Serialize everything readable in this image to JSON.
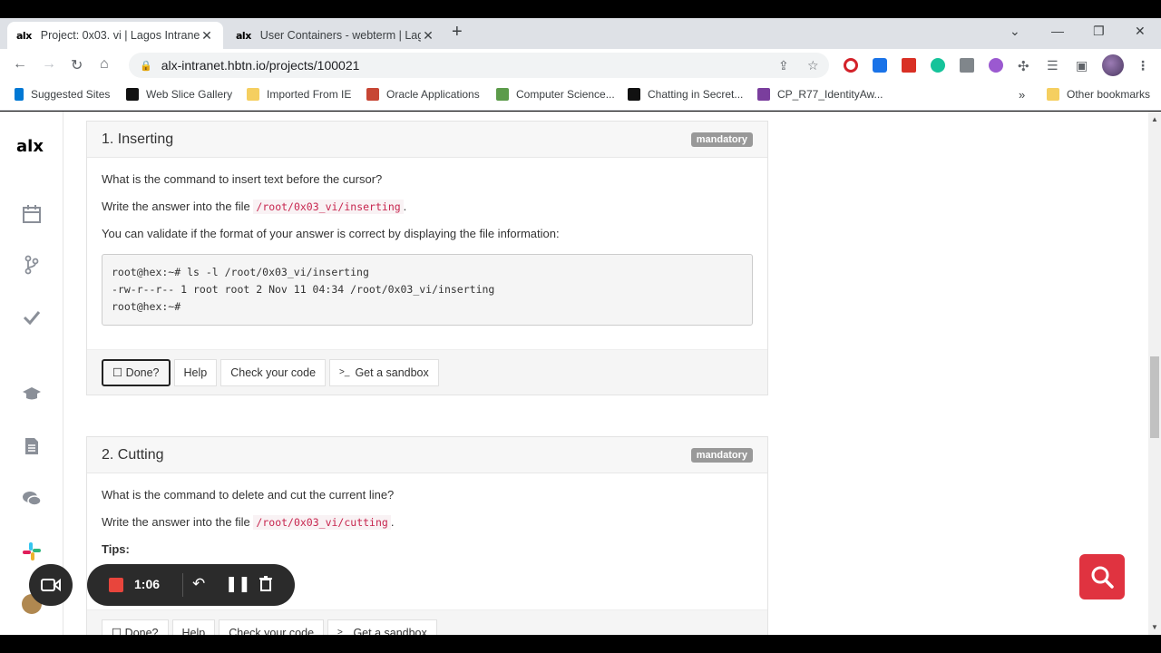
{
  "tabs": [
    {
      "favicon": "alx",
      "title": "Project: 0x03. vi | Lagos Intranet"
    },
    {
      "favicon": "alx",
      "title": "User Containers - webterm | Lagos"
    }
  ],
  "address": {
    "url": "alx-intranet.hbtn.io/projects/100021"
  },
  "bookmarks": {
    "items": [
      "Suggested Sites",
      "Web Slice Gallery",
      "Imported From IE",
      "Oracle Applications",
      "Computer Science...",
      "Chatting in Secret...",
      "CP_R77_IdentityAw..."
    ],
    "more": "»",
    "other": "Other bookmarks"
  },
  "sidebar": {
    "logo": "alx"
  },
  "task1": {
    "title": "1. Inserting",
    "badge": "mandatory",
    "question": "What is the command to insert text before the cursor?",
    "write_prefix": "Write the answer into the file",
    "file": "/root/0x03_vi/inserting",
    "write_suffix": ".",
    "validate": "You can validate if the format of your answer is correct by displaying the file information:",
    "code_lines": [
      "root@hex:~# ls -l /root/0x03_vi/inserting",
      "-rw-r--r-- 1 root root 2 Nov 11 04:34 /root/0x03_vi/inserting",
      "root@hex:~#"
    ],
    "buttons": {
      "done": "☐ Done?",
      "help": "Help",
      "check": "Check your code",
      "sandbox": "Get a sandbox",
      "sandbox_icon": ">_"
    }
  },
  "task2": {
    "title": "2. Cutting",
    "badge": "mandatory",
    "question": "What is the command to delete and cut the current line?",
    "write_prefix": "Write the answer into the file",
    "file": "/root/0x03_vi/cutting",
    "write_suffix": ".",
    "tips": "Tips:",
    "buttons": {
      "done": "☐ Done?",
      "help": "Help",
      "check": "Check your code",
      "sandbox": "Get a sandbox",
      "sandbox_icon": ">_"
    }
  },
  "recorder": {
    "time": "1:06"
  },
  "colors": {
    "recorder_bg": "#2b2b2b",
    "record_red": "#e8453c",
    "search_fab": "#e03340",
    "badge": "#999999",
    "code_pink": "#c7254e"
  }
}
